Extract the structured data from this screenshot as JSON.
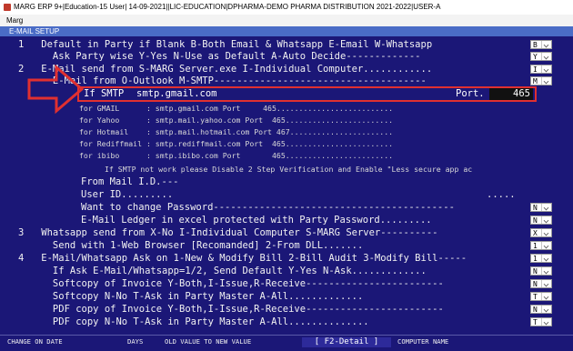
{
  "title": "MARG ERP 9+|Education-15 User| 14-09-2021||LIC-EDUCATION|DPHARMA-DEMO PHARMA DISTRIBUTION 2021-2022|USER-A",
  "menu": "Marg",
  "panel_title": "E-MAIL SETUP",
  "rows": {
    "r1": "1   Default in Party if Blank B-Both Email & Whatsapp E-Email W-Whatsapp",
    "r1b": "      Ask Party wise Y-Yes N-Use as Default A-Auto Decide-------------",
    "r2": "2   E-Mail send from S-MARG Server.exe I-Individual Computer............",
    "r2b": "      E-Mail from O-Outlook M-SMTP-------------------------------------",
    "g1": "for GMAIL      : smtp.gmail.com Port     465..........................",
    "g2": "for Yahoo      : smtp.mail.yahoo.com Port  465........................",
    "g3": "for Hotmail    : smtp.mail.hotmail.com Port 467.......................",
    "g4": "for Rediffmail : smtp.rediffmail.com Port  465........................",
    "g5": "for ibibo      : smtp.ibibo.com Port       465........................",
    "note": "If SMTP not work please Disable 2 Step Verification and Enable \"Less secure app ac",
    "from": "From Mail I.D.---",
    "user": "User ID.........",
    "user_dots": ".....",
    "pwd": "Want to change Password------------------------------------------",
    "ledger": "E-Mail Ledger in excel protected with Party Password.........",
    "r3": "3   Whatsapp send from X-No I-Individual Computer S-MARG Server----------",
    "r3b": "      Send with 1-Web Browser [Recomanded] 2-From DLL.......",
    "r4": "4   E-Mail/Whatsapp Ask on 1-New & Modify Bill 2-Bill Audit 3-Modify Bill-----",
    "r4a": "      If Ask E-Mail/Whatsapp=1/2, Send Default Y-Yes N-Ask.............",
    "r4b": "      Softcopy of Invoice Y-Both,I-Issue,R-Receive------------------------",
    "r4c": "      Softcopy N-No T-Ask in Party Master A-All.............",
    "r4d": "      PDF copy of Invoice Y-Both,I-Issue,R-Receive------------------------",
    "r4e": "      PDF copy N-No T-Ask in Party Master A-All.............."
  },
  "smtp": {
    "label": "If SMTP",
    "value": "smtp.gmail.com",
    "port_label": "Port.",
    "port_value": "465"
  },
  "dropdowns": {
    "d1": "B",
    "d2": "Y",
    "d3": "I",
    "d4": "M",
    "d5": "N",
    "d6": "N",
    "d7": "X",
    "d8": "1",
    "d9": "1",
    "d10": "N",
    "d11": "N",
    "d12": "T",
    "d13": "N",
    "d14": "T"
  },
  "status": {
    "change_on_date": "CHANGE ON DATE",
    "days": "DAYS",
    "old_new": "OLD VALUE TO NEW VALUE",
    "f2": "[ F2-Detail ]",
    "computer": "COMPUTER NAME"
  },
  "colors": {
    "background": "#1b1777",
    "title_bar": "#4a6cc6",
    "highlight_box": "#e03030"
  }
}
